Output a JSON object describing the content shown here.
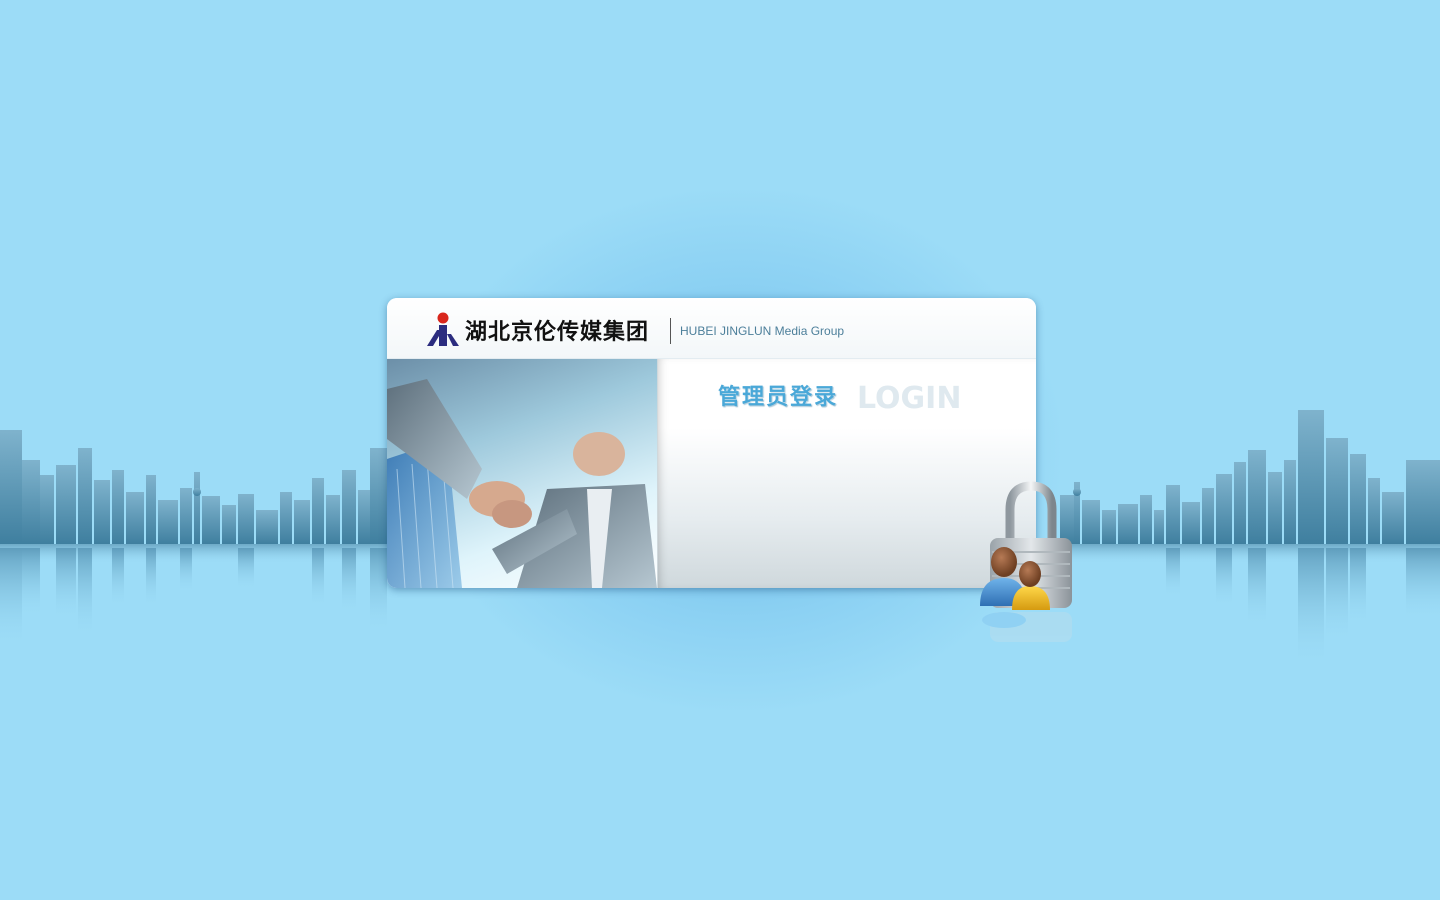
{
  "header": {
    "company_name_cn": "湖北京伦传媒集团",
    "company_name_en": "HUBEI JINGLUN Media Group",
    "logo_icon": "jinglun-logo-icon"
  },
  "login": {
    "title_cn": "管理员登录",
    "title_en": "LOGIN"
  },
  "icons": {
    "lock": "padlock-users-icon",
    "photo": "handshake-photo"
  },
  "colors": {
    "background": "#9cdcf7",
    "title_accent": "#4aa8d8",
    "logo_red": "#d9261c",
    "logo_navy": "#2b2c7f"
  }
}
